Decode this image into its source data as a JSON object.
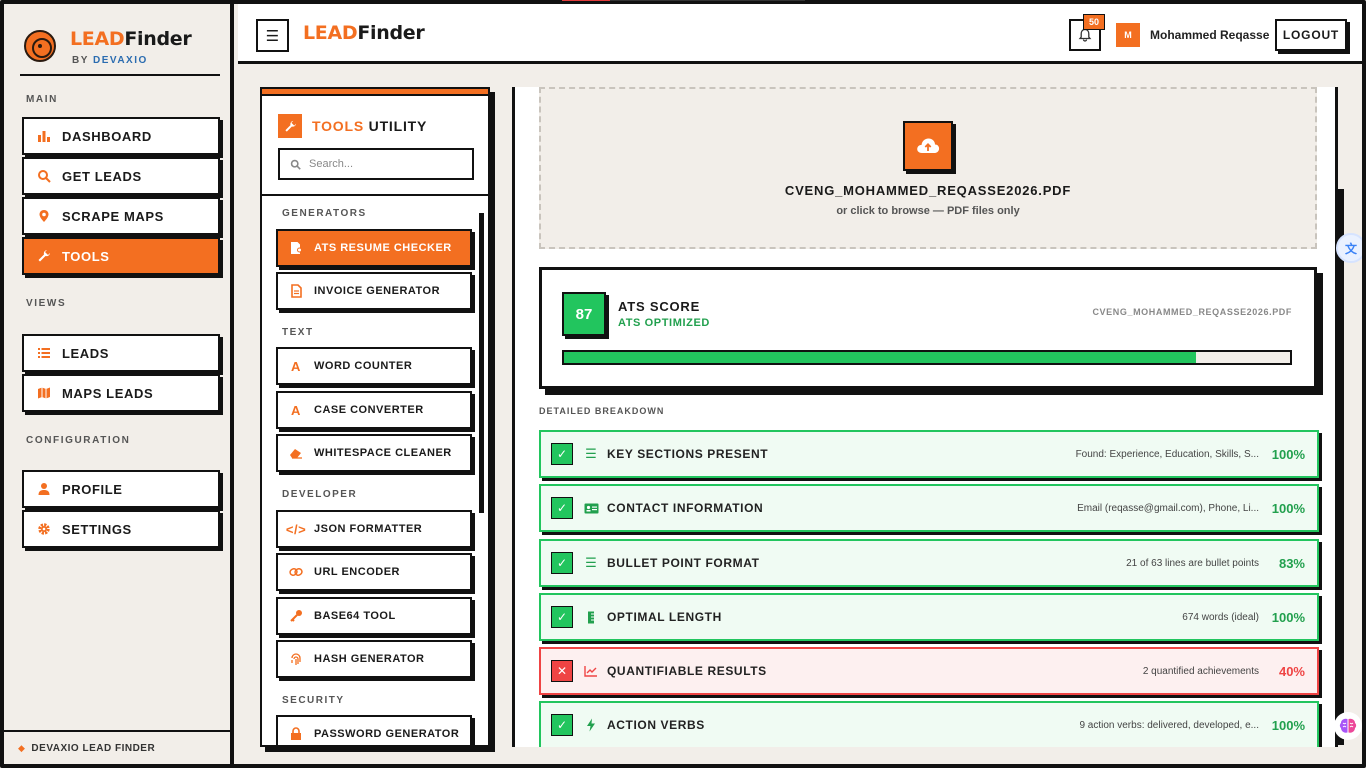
{
  "brand": {
    "lead": "LEAD",
    "finder": "Finder",
    "by": "BY",
    "company": "DEVAXIO"
  },
  "sidebar": {
    "sections": [
      {
        "label": "MAIN",
        "items": [
          {
            "label": "DASHBOARD",
            "icon": "bar-chart-icon"
          },
          {
            "label": "GET LEADS",
            "icon": "search-icon"
          },
          {
            "label": "SCRAPE MAPS",
            "icon": "map-pin-icon"
          },
          {
            "label": "TOOLS",
            "icon": "wrench-icon",
            "active": true
          }
        ]
      },
      {
        "label": "VIEWS",
        "items": [
          {
            "label": "LEADS",
            "icon": "list-icon"
          },
          {
            "label": "MAPS LEADS",
            "icon": "map-icon"
          }
        ]
      },
      {
        "label": "CONFIGURATION",
        "items": [
          {
            "label": "PROFILE",
            "icon": "user-icon"
          },
          {
            "label": "SETTINGS",
            "icon": "gear-icon"
          }
        ]
      }
    ],
    "footer": "DEVAXIO LEAD FINDER"
  },
  "topbar": {
    "menu_icon": "hamburger-icon",
    "notifications_count": "50",
    "avatar_initial": "M",
    "username": "Mohammed Reqasse",
    "logout_label": "LOGOUT"
  },
  "tools": {
    "title_orange": "TOOLS",
    "title_rest": "UTILITY",
    "search_placeholder": "Search...",
    "groups": [
      {
        "label": "GENERATORS",
        "items": [
          {
            "label": "ATS RESUME CHECKER",
            "icon": "file-user-icon",
            "active": true
          },
          {
            "label": "INVOICE GENERATOR",
            "icon": "document-icon"
          }
        ]
      },
      {
        "label": "TEXT",
        "items": [
          {
            "label": "WORD COUNTER",
            "icon": "text-a-icon"
          },
          {
            "label": "CASE CONVERTER",
            "icon": "text-a-icon"
          },
          {
            "label": "WHITESPACE CLEANER",
            "icon": "eraser-icon"
          }
        ]
      },
      {
        "label": "DEVELOPER",
        "items": [
          {
            "label": "JSON FORMATTER",
            "icon": "code-icon"
          },
          {
            "label": "URL ENCODER",
            "icon": "link-icon"
          },
          {
            "label": "BASE64 TOOL",
            "icon": "key-icon"
          },
          {
            "label": "HASH GENERATOR",
            "icon": "fingerprint-icon"
          }
        ]
      },
      {
        "label": "SECURITY",
        "items": [
          {
            "label": "PASSWORD GENERATOR",
            "icon": "lock-icon"
          }
        ]
      }
    ]
  },
  "upload": {
    "file_name": "CVENG_MOHAMMED_REQASSE2026.PDF",
    "hint": "or click to browse — PDF files only"
  },
  "score": {
    "value": "87",
    "percent": 87,
    "title": "ATS SCORE",
    "status": "ATS OPTIMIZED",
    "file_name": "CVENG_MOHAMMED_REQASSE2026.PDF"
  },
  "breakdown": {
    "label": "DETAILED BREAKDOWN",
    "rows": [
      {
        "name": "KEY SECTIONS PRESENT",
        "detail": "Found: Experience, Education, Skills, S...",
        "pct": "100%",
        "pass": true,
        "icon": "checklist-icon"
      },
      {
        "name": "CONTACT INFORMATION",
        "detail": "Email (reqasse@gmail.com), Phone, Li...",
        "pct": "100%",
        "pass": true,
        "icon": "id-card-icon"
      },
      {
        "name": "BULLET POINT FORMAT",
        "detail": "21 of 63 lines are bullet points",
        "pct": "83%",
        "pass": true,
        "icon": "list-icon"
      },
      {
        "name": "OPTIMAL LENGTH",
        "detail": "674 words (ideal)",
        "pct": "100%",
        "pass": true,
        "icon": "ruler-icon"
      },
      {
        "name": "QUANTIFIABLE RESULTS",
        "detail": "2 quantified achievements",
        "pct": "40%",
        "pass": false,
        "icon": "trend-chart-icon"
      },
      {
        "name": "ACTION VERBS",
        "detail": "9 action verbs: delivered, developed, e...",
        "pct": "100%",
        "pass": true,
        "icon": "bolt-icon"
      }
    ]
  },
  "colors": {
    "accent": "#f36f21",
    "success": "#22c55e",
    "danger": "#ef4444",
    "background": "#f2eee9"
  }
}
